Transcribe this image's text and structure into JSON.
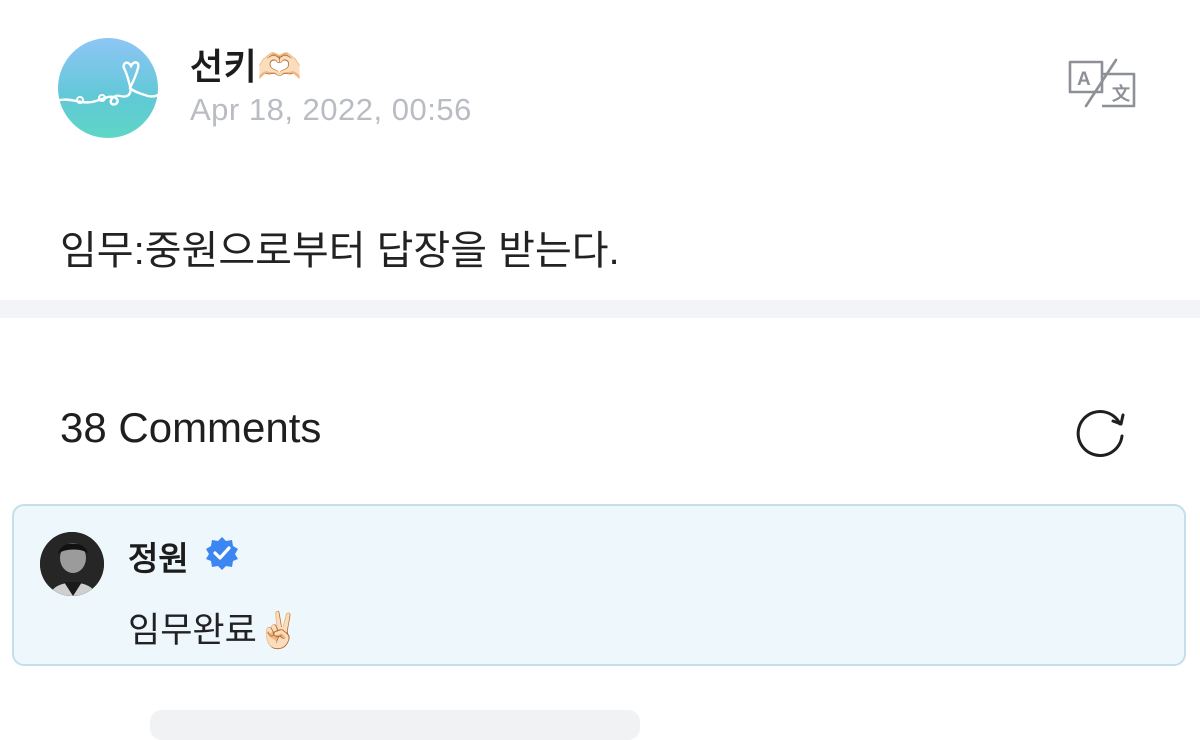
{
  "post": {
    "author": "선키🫶🏻",
    "timestamp": "Apr 18, 2022, 00:56",
    "body": "임무:중원으로부터 답장을 받는다.",
    "translate_icon": "translate-icon"
  },
  "comments": {
    "header": "38 Comments",
    "refresh_icon": "refresh-icon",
    "items": [
      {
        "author": "정원",
        "verified": true,
        "text": "임무완료✌🏻"
      }
    ]
  },
  "colors": {
    "timestamp": "#b9bcc3",
    "comment_card_bg": "#edf7fc",
    "comment_card_border": "#c4dfe9",
    "verified_badge": "#3b86f0",
    "divider": "#f3f4f7"
  }
}
